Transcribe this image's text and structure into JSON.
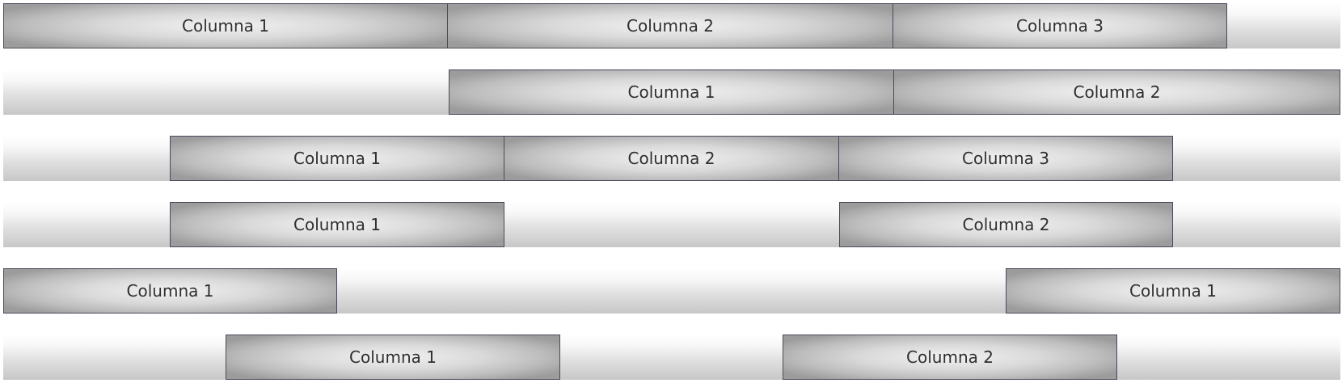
{
  "rows": [
    {
      "columns": [
        {
          "label": "Columna 1"
        },
        {
          "label": "Columna 2"
        },
        {
          "label": "Columna 3"
        }
      ]
    },
    {
      "columns": [
        {
          "label": "Columna 1"
        },
        {
          "label": "Columna 2"
        }
      ]
    },
    {
      "columns": [
        {
          "label": "Columna 1"
        },
        {
          "label": "Columna 2"
        },
        {
          "label": "Columna 3"
        }
      ]
    },
    {
      "columns": [
        {
          "label": "Columna 1"
        },
        {
          "label": "Columna 2"
        }
      ]
    },
    {
      "columns": [
        {
          "label": "Columna 1"
        },
        {
          "label": "Columna 1"
        }
      ]
    },
    {
      "columns": [
        {
          "label": "Columna 1"
        },
        {
          "label": "Columna 2"
        }
      ]
    }
  ]
}
